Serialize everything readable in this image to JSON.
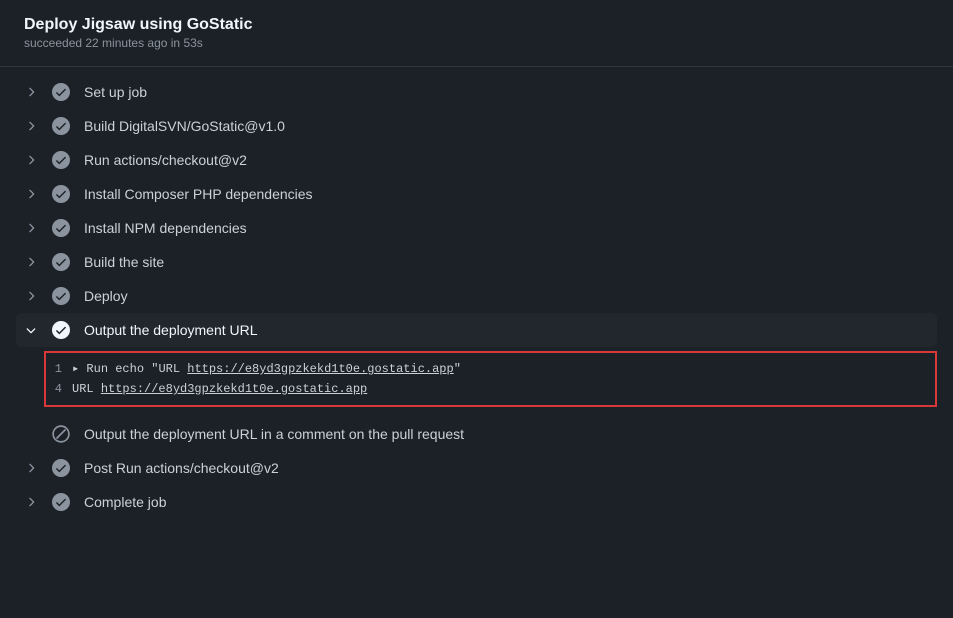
{
  "header": {
    "title": "Deploy Jigsaw using GoStatic",
    "subtitle": "succeeded 22 minutes ago in 53s"
  },
  "steps": [
    {
      "title": "Set up job",
      "status": "success",
      "expanded": false
    },
    {
      "title": "Build DigitalSVN/GoStatic@v1.0",
      "status": "success",
      "expanded": false
    },
    {
      "title": "Run actions/checkout@v2",
      "status": "success",
      "expanded": false
    },
    {
      "title": "Install Composer PHP dependencies",
      "status": "success",
      "expanded": false
    },
    {
      "title": "Install NPM dependencies",
      "status": "success",
      "expanded": false
    },
    {
      "title": "Build the site",
      "status": "success",
      "expanded": false
    },
    {
      "title": "Deploy",
      "status": "success",
      "expanded": false
    },
    {
      "title": "Output the deployment URL",
      "status": "success",
      "expanded": true
    },
    {
      "title": "Output the deployment URL in a comment on the pull request",
      "status": "skipped",
      "expanded": false,
      "no_chevron": true
    },
    {
      "title": "Post Run actions/checkout@v2",
      "status": "success",
      "expanded": false
    },
    {
      "title": "Complete job",
      "status": "success",
      "expanded": false
    }
  ],
  "log": {
    "lines": [
      {
        "no": "1",
        "prefix": "▸ Run echo \"URL ",
        "url": "https://e8yd3gpzkekd1t0e.gostatic.app",
        "suffix": "\""
      },
      {
        "no": "4",
        "prefix": "URL ",
        "url": "https://e8yd3gpzkekd1t0e.gostatic.app",
        "suffix": ""
      }
    ]
  }
}
